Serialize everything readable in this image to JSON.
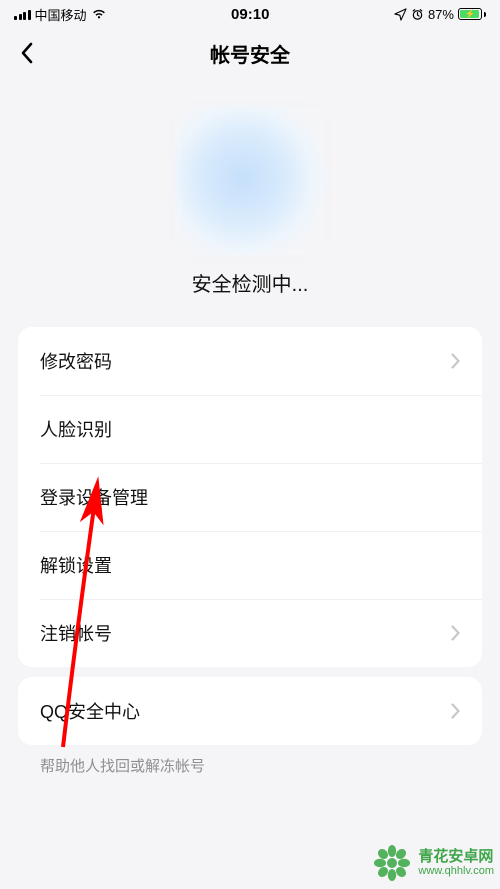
{
  "statusbar": {
    "carrier": "中国移动",
    "time": "09:10",
    "battery_pct": "87%"
  },
  "nav": {
    "title": "帐号安全"
  },
  "hero": {
    "status": "安全检测中..."
  },
  "group1": {
    "items": [
      {
        "label": "修改密码",
        "has_chevron": true
      },
      {
        "label": "人脸识别",
        "has_chevron": false
      },
      {
        "label": "登录设备管理",
        "has_chevron": false
      },
      {
        "label": "解锁设置",
        "has_chevron": false
      },
      {
        "label": "注销帐号",
        "has_chevron": true
      }
    ]
  },
  "group2": {
    "items": [
      {
        "label": "QQ安全中心",
        "has_chevron": true
      }
    ]
  },
  "footer_hint": "帮助他人找回或解冻帐号",
  "watermark": {
    "name": "青花安卓网",
    "url": "www.qhhlv.com"
  },
  "colors": {
    "arrow": "#ff0000",
    "battery_fill": "#4cd964",
    "brand_green": "#3fa64a"
  }
}
